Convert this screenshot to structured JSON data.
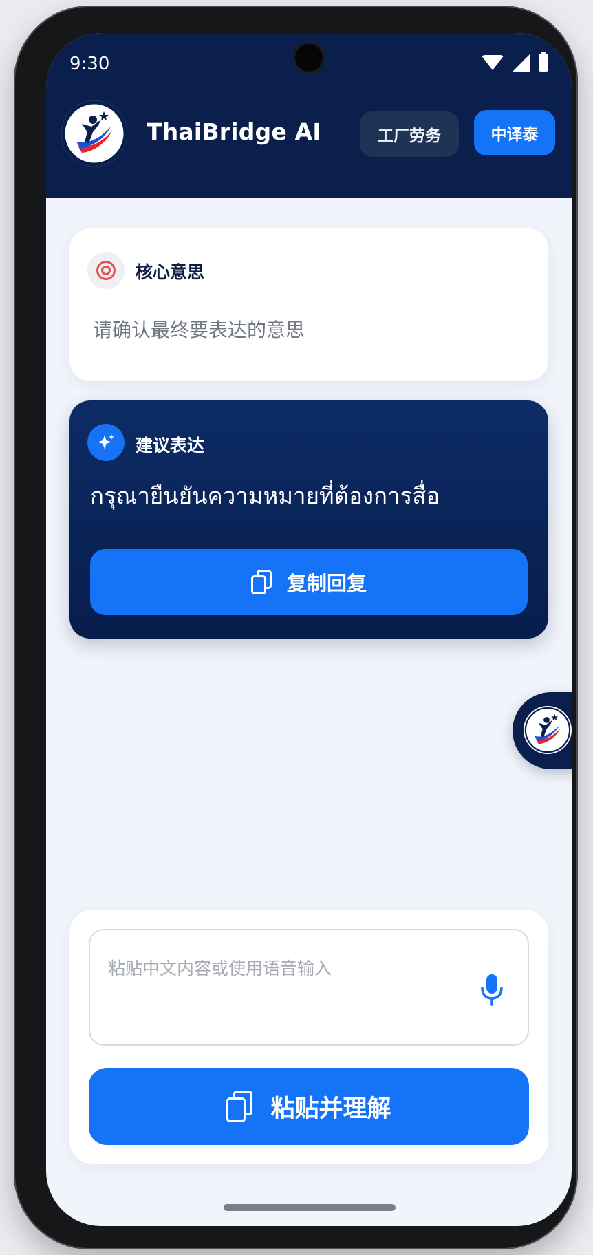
{
  "status_bar": {
    "time": "9:30"
  },
  "header": {
    "app_title": "ThaiBridge AI",
    "labor_button": "工厂劳务",
    "translate_button": "中译泰",
    "accent_color": "#1473f7",
    "background_color": "#0a1f4b"
  },
  "core_meaning": {
    "title": "核心意思",
    "text": "请确认最终要表达的意思",
    "icon": "target-icon"
  },
  "suggestion": {
    "title": "建议表达",
    "thai_text": "กรุณายืนยันความหมายที่ต้องการสื่อ",
    "copy_button": "复制回复",
    "icon": "sparkle-icon"
  },
  "input": {
    "placeholder": "粘贴中文内容或使用语音输入",
    "paste_button": "粘贴并理解",
    "mic_icon": "microphone-icon"
  }
}
